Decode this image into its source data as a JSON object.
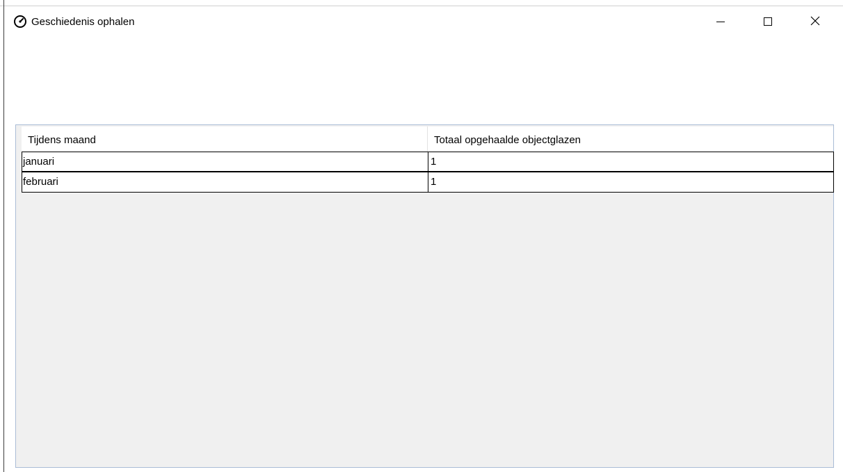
{
  "window": {
    "title": "Geschiedenis ophalen",
    "icon": "gauge-icon",
    "controls": {
      "minimize_icon": "minimize-icon",
      "maximize_icon": "maximize-icon",
      "close_icon": "close-icon"
    }
  },
  "grid": {
    "columns": [
      "Tijdens maand",
      "Totaal opgehaalde objectglazen"
    ],
    "rows": [
      {
        "month": "januari",
        "total": "1"
      },
      {
        "month": "februari",
        "total": "1"
      }
    ],
    "colors": {
      "frame_border": "#a9bcd6",
      "background": "#f0f0f0"
    }
  }
}
